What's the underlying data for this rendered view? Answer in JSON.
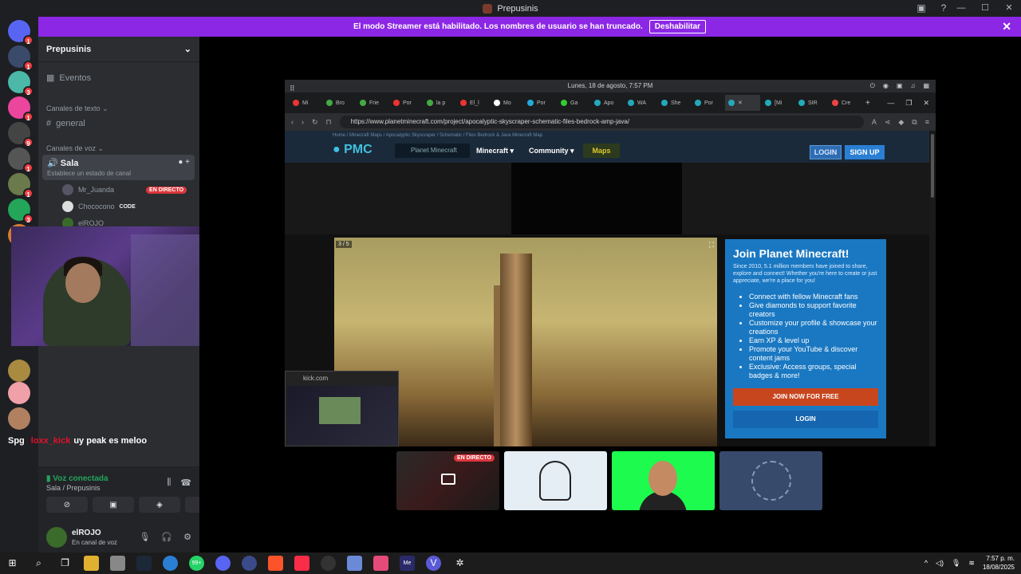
{
  "window": {
    "title": "Prepusinis"
  },
  "banner": {
    "text": "El modo Streamer está habilitado. Los nombres de usuario se han truncado.",
    "button": "Deshabilitar"
  },
  "server": {
    "name": "Prepusinis"
  },
  "channels": {
    "events": "Eventos",
    "text_category": "Canales de texto",
    "general": "general",
    "voice_category": "Canales de voz",
    "voice_channel": {
      "name": "Sala",
      "status": "Establece un estado de canal"
    },
    "members": [
      {
        "name": "Mr_Juanda",
        "badge": "EN DIRECTO"
      },
      {
        "name": "Chococono",
        "badge": "CODE"
      },
      {
        "name": "elROJO"
      }
    ]
  },
  "guild_badges": [
    "1",
    "1",
    "3",
    "1",
    "9",
    "1",
    "1",
    "3"
  ],
  "chat_overlay": {
    "tag": "Spg",
    "user": "loxx_kick",
    "message": "uy peak es meloo"
  },
  "voice_panel": {
    "status": "Voz conectada",
    "location": "Sala / Prepusinis"
  },
  "user_panel": {
    "name": "elROJO",
    "status": "En canal de voz"
  },
  "browser": {
    "date": "Lunes, 18 de agosto, 7:57 PM",
    "url": "https://www.planetminecraft.com/project/apocalyptic-skyscraper-schematic-files-bedrock-amp-java/",
    "tabs": [
      "Mi",
      "Bro",
      "Frie",
      "Por",
      "la p",
      "El_l",
      "Mo",
      "Por",
      "Ga",
      "Apo",
      "WA",
      "She",
      "Por",
      "",
      "[Mi",
      "SIR",
      "Cre"
    ]
  },
  "pmc": {
    "breadcrumb": "Home / Minecraft Maps / Apocalyptic Skyscraper / Schematic / Files Bedrock & Java Minecraft Map",
    "logo": "PMC",
    "search": "Planet Minecraft",
    "nav_minecraft": "Minecraft ▾",
    "nav_community": "Community ▾",
    "nav_maps": "Maps",
    "login": "LOGIN",
    "signup": "SIGN UP",
    "gallery_counter": "3 / 5",
    "join": {
      "title": "Join Planet Minecraft!",
      "intro": "Since 2010, 5.1 million members have joined to share, explore and connect! Whether you're here to create or just appreciate, we're a place for you!",
      "bullets": [
        "Connect with fellow Minecraft fans",
        "Give diamonds to support favorite creators",
        "Customize your profile & showcase your creations",
        "Earn XP & level up",
        "Promote your YouTube & discover content jams",
        "Exclusive: Access groups, special badges & more!"
      ],
      "join_button": "JOIN NOW FOR FREE",
      "login_button": "LOGIN"
    }
  },
  "mini_popup": {
    "title": "kick.com"
  },
  "tiles": {
    "live_tag": "EN DIRECTO"
  },
  "taskbar": {
    "badge": "99+",
    "time": "7:57 p. m.",
    "date": "18/08/2025"
  }
}
